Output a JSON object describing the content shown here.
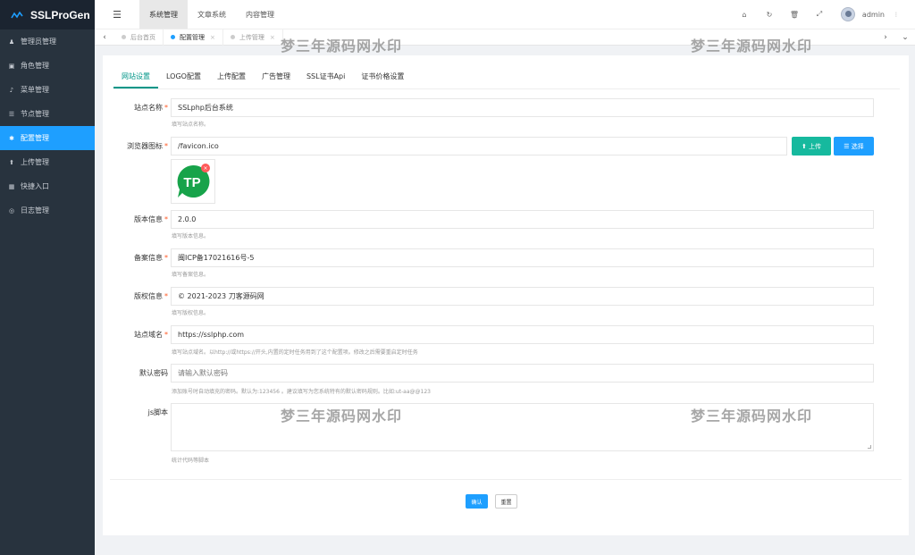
{
  "app": {
    "title": "SSLProGen"
  },
  "sidebar": {
    "items": [
      {
        "label": "管理员管理",
        "icon": "user-icon",
        "active": false
      },
      {
        "label": "角色管理",
        "icon": "id-card-icon",
        "active": false
      },
      {
        "label": "菜单管理",
        "icon": "bell-icon",
        "active": false
      },
      {
        "label": "节点管理",
        "icon": "list-icon",
        "active": false
      },
      {
        "label": "配置管理",
        "icon": "gear-icon",
        "active": true
      },
      {
        "label": "上传管理",
        "icon": "upload-icon",
        "active": false
      },
      {
        "label": "快捷入口",
        "icon": "grid-icon",
        "active": false
      },
      {
        "label": "日志管理",
        "icon": "log-icon",
        "active": false
      }
    ]
  },
  "topnav": {
    "items": [
      {
        "label": "系统管理",
        "active": true
      },
      {
        "label": "文章系统",
        "active": false
      },
      {
        "label": "内容管理",
        "active": false
      }
    ],
    "user": "admin"
  },
  "tabs": {
    "items": [
      {
        "label": "后台首页",
        "active": false,
        "closable": false
      },
      {
        "label": "配置管理",
        "active": true,
        "closable": true
      },
      {
        "label": "上传管理",
        "active": false,
        "closable": true
      }
    ]
  },
  "watermark": {
    "text": "梦三年源码网水印"
  },
  "config_tabs": {
    "items": [
      {
        "label": "网站设置",
        "active": true
      },
      {
        "label": "LOGO配置",
        "active": false
      },
      {
        "label": "上传配置",
        "active": false
      },
      {
        "label": "广告管理",
        "active": false
      },
      {
        "label": "SSL证书Api",
        "active": false
      },
      {
        "label": "证书价格设置",
        "active": false
      }
    ]
  },
  "form": {
    "site_name": {
      "label": "站点名称",
      "value": "SSLphp后台系统",
      "hint": "填写站点名称。"
    },
    "favicon": {
      "label": "浏览器图标",
      "value": "/favicon.ico",
      "upload_label": "上传",
      "select_label": "选择",
      "preview_text": "TP"
    },
    "version": {
      "label": "版本信息",
      "value": "2.0.0",
      "hint": "填写版本信息。"
    },
    "icp": {
      "label": "备案信息",
      "value": "闽ICP备17021616号-5",
      "hint": "填写备案信息。"
    },
    "copyright": {
      "label": "版权信息",
      "value": "© 2021-2023 刀客源码网",
      "hint": "填写版权信息。"
    },
    "domain": {
      "label": "站点域名",
      "value": "https://sslphp.com",
      "hint": "填写站点域名。以http://或https://开头,内置的定时任务用到了这个配置项。修改之后需要重启定时任务"
    },
    "default_password": {
      "label": "默认密码",
      "placeholder": "请输入默认密码",
      "hint": "添加账号时自动填充的密码。默认为:123456 。建议填写为您系统特有的默认密码规则。比如:ut-aa@@123"
    },
    "js": {
      "label": "js脚本",
      "value": "",
      "hint": "统计代码等脚本"
    }
  },
  "actions": {
    "confirm": "确认",
    "reset": "重置"
  }
}
